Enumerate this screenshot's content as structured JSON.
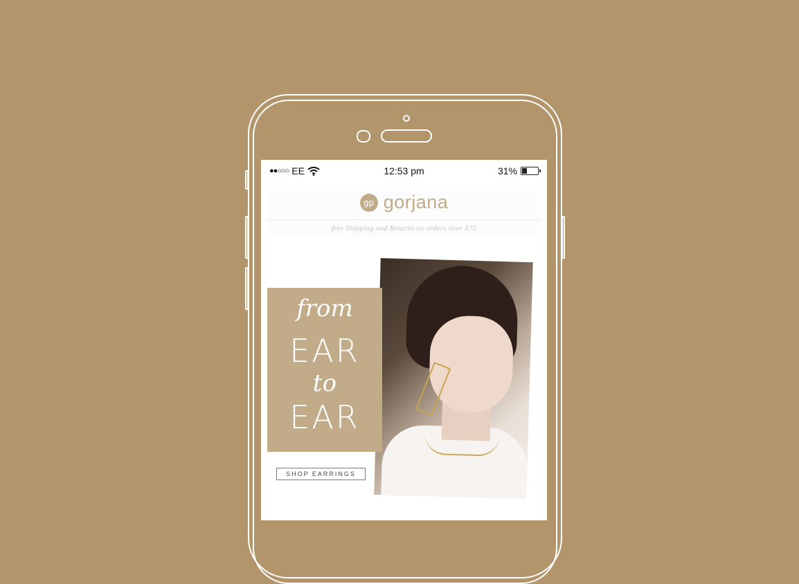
{
  "status_bar": {
    "signal": "●●○○○",
    "carrier": "EE",
    "time": "12:53 pm",
    "battery": "31%",
    "battery_level": 0.31
  },
  "brand": {
    "logo_mark": "gp",
    "name": "gorjana",
    "accent_color": "#c2ab88"
  },
  "promo": {
    "text": "free Shipping and Returns on orders over $75"
  },
  "hero": {
    "line1": "from",
    "line2": "EAR",
    "line3": "to",
    "line4": "EAR",
    "cta_label": "SHOP EARRINGS"
  },
  "colors": {
    "background": "#b2956a",
    "card": "#c1ab88"
  }
}
